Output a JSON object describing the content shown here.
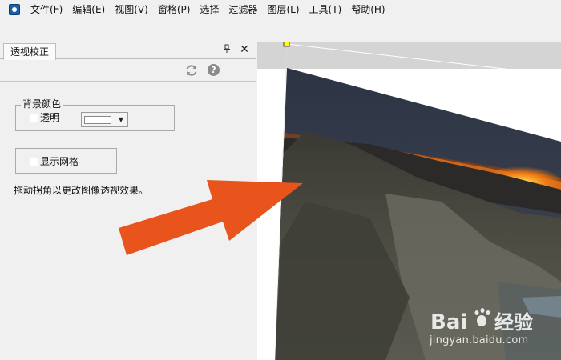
{
  "menu": {
    "items": [
      "文件(F)",
      "编辑(E)",
      "视图(V)",
      "窗格(P)",
      "选择",
      "过滤器",
      "图层(L)",
      "工具(T)",
      "帮助(H)"
    ]
  },
  "panel": {
    "tab_label": "透视校正",
    "pin_icon": "📌",
    "close_icon": "✕",
    "help_icon": "?",
    "background_group": {
      "title": "背景颜色",
      "transparent_label": "透明",
      "transparent_checked": false,
      "color_value": "#ffffff",
      "dropdown_arrow": "▼"
    },
    "grid_group": {
      "show_grid_label": "显示网格",
      "show_grid_checked": false
    },
    "hint": "拖动拐角以更改图像透视效果。"
  },
  "canvas": {
    "background_color": "#d4d4d4",
    "handle_color": "#ffff00",
    "arrow_color": "#e8541c"
  },
  "watermark": {
    "logo_text": "Bai",
    "logo_text2": "经验",
    "url": "jingyan.baidu.com"
  }
}
